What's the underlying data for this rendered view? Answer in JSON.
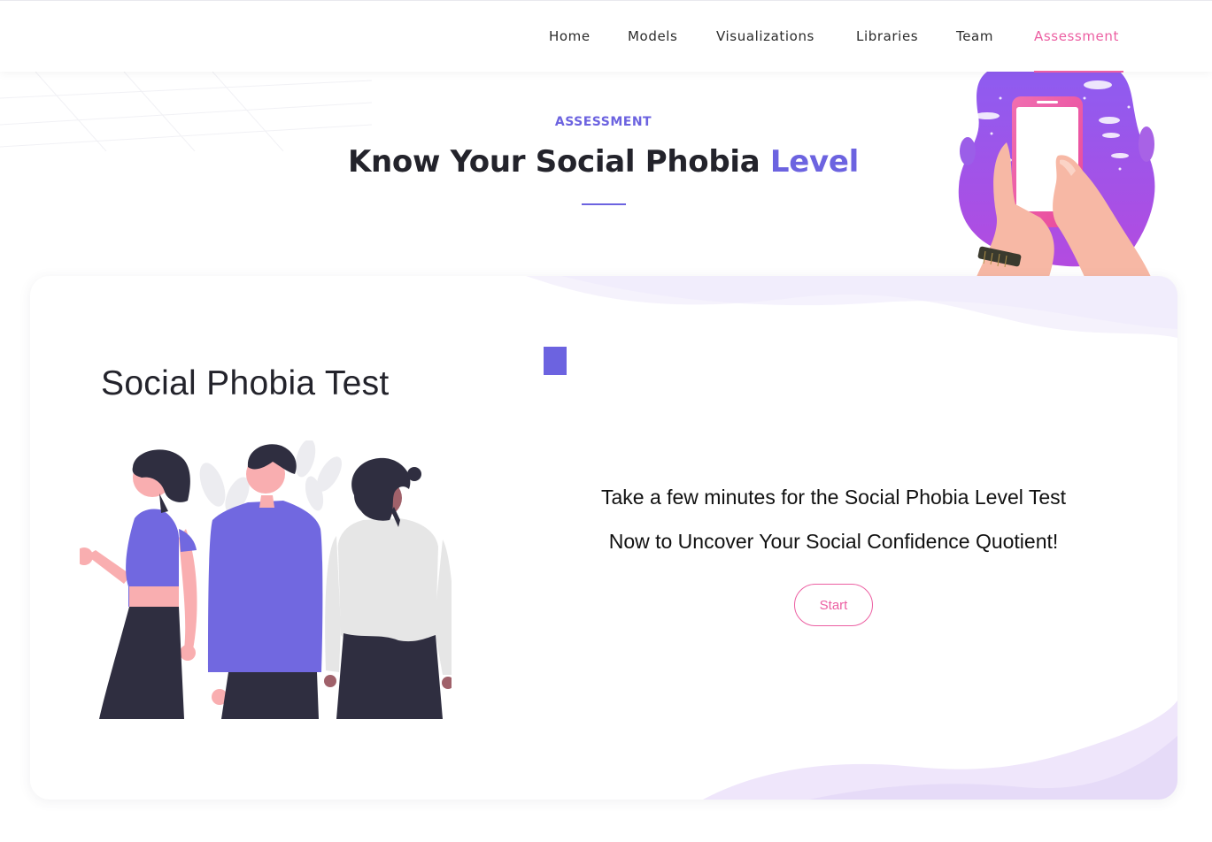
{
  "nav": {
    "items": [
      {
        "label": "Home"
      },
      {
        "label": "Models"
      },
      {
        "label": "Visualizations"
      },
      {
        "label": "Libraries"
      },
      {
        "label": "Team"
      },
      {
        "label": "Assessment",
        "active": true
      }
    ]
  },
  "hero": {
    "eyebrow": "ASSESSMENT",
    "title_main": "Know Your Social Phobia ",
    "title_accent": "Level"
  },
  "card": {
    "title": "Social Phobia Test",
    "line1": "Take a few minutes for the Social Phobia Level Test",
    "line2": "Now to Uncover Your Social Confidence Quotient!",
    "start_label": "Start"
  },
  "colors": {
    "accent_purple": "#6c63e0",
    "accent_pink": "#ec5fa2"
  }
}
